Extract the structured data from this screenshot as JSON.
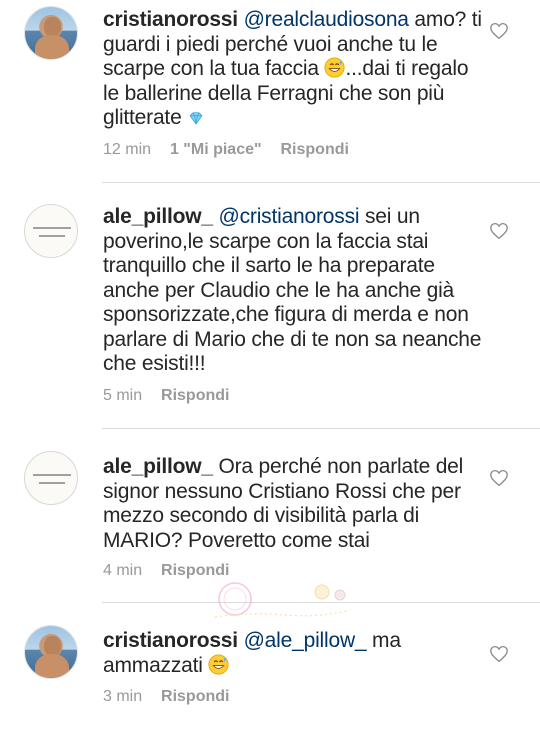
{
  "comments": [
    {
      "username": "cristianorossi",
      "mention": "@realclaudiosona",
      "text_before_emoji": " amo? ti guardi i piedi perché vuoi anche tu le scarpe con la tua faccia ",
      "text_after_emoji": "...dai ti regalo le ballerine della Ferragni che son più glitterate ",
      "emoji1": "grinning-sweat-emoji",
      "emoji2": "diamond-emoji",
      "time": "12 min",
      "likes": "1 \"Mi piace\"",
      "reply": "Rispondi",
      "avatar": "profile-photo"
    },
    {
      "username": "ale_pillow_",
      "mention": "@cristianorossi",
      "text": " sei un poverino,le scarpe con la faccia stai tranquillo che il sarto le ha preparate anche per Claudio che le ha anche già sponsorizzate,che figura di merda e non parlare di Mario che di te non sa neanche che esisti!!!",
      "time": "5 min",
      "reply": "Rispondi",
      "avatar": "logo"
    },
    {
      "username": "ale_pillow_",
      "text": " Ora perché non parlate del signor nessuno Cristiano Rossi che per mezzo secondo di visibilità parla di MARIO? Poveretto come stai",
      "time": "4 min",
      "reply": "Rispondi",
      "avatar": "logo"
    },
    {
      "username": "cristianorossi",
      "mention": "@ale_pillow_",
      "text_before_emoji": " ma ammazzati ",
      "emoji1": "grinning-sweat-emoji",
      "time": "3 min",
      "reply": "Rispondi",
      "avatar": "profile-photo"
    }
  ],
  "colors": {
    "text": "#262626",
    "mention": "#003569",
    "meta": "#999999",
    "divider": "#dbdbdb"
  }
}
